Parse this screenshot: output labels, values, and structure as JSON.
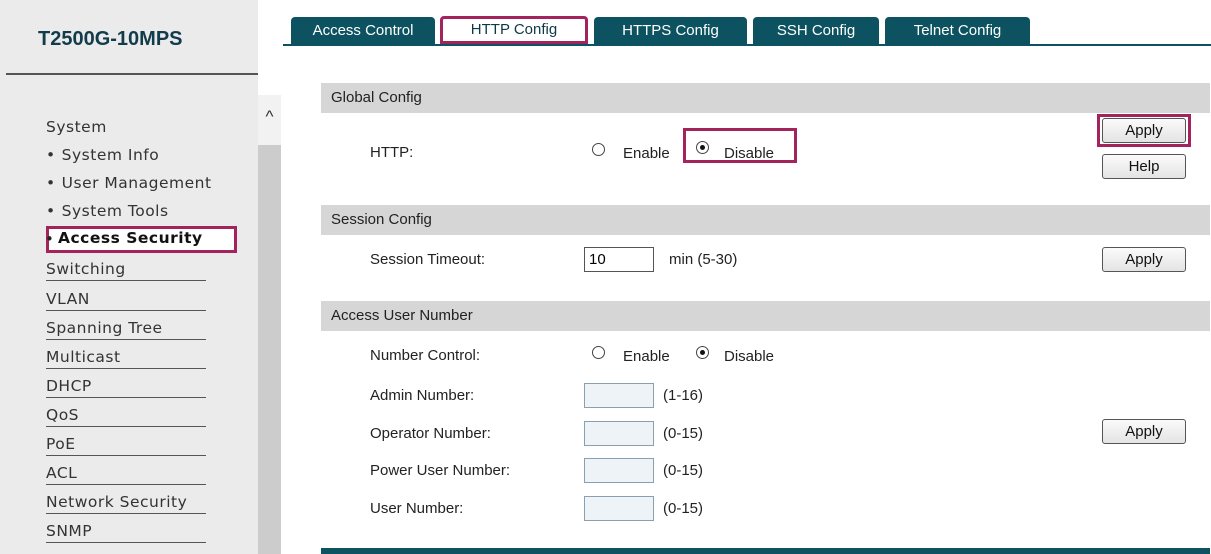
{
  "sidebar": {
    "model": "T2500G-10MPS",
    "scroll_up_glyph": "^",
    "system_label": "System",
    "sub_items": [
      "System Info",
      "User Management",
      "System Tools"
    ],
    "active_item": "Access Security",
    "categories": [
      "Switching",
      "VLAN",
      "Spanning Tree",
      "Multicast",
      "DHCP",
      "QoS",
      "PoE",
      "ACL",
      "Network Security",
      "SNMP"
    ]
  },
  "tabs": [
    "Access Control",
    "HTTP Config",
    "HTTPS Config",
    "SSH Config",
    "Telnet Config"
  ],
  "active_tab": "HTTP Config",
  "global_config": {
    "title": "Global Config",
    "http_label": "HTTP:",
    "enable_label": "Enable",
    "disable_label": "Disable",
    "selected": "Disable",
    "apply_label": "Apply",
    "help_label": "Help"
  },
  "session_config": {
    "title": "Session Config",
    "timeout_label": "Session Timeout:",
    "timeout_value": "10",
    "timeout_unit": "min (5-30)",
    "apply_label": "Apply"
  },
  "access_user_number": {
    "title": "Access User Number",
    "number_control_label": "Number Control:",
    "enable_label": "Enable",
    "disable_label": "Disable",
    "selected": "Disable",
    "rows": [
      {
        "label": "Admin Number:",
        "range": "(1-16)",
        "value": ""
      },
      {
        "label": "Operator Number:",
        "range": "(0-15)",
        "value": ""
      },
      {
        "label": "Power User Number:",
        "range": "(0-15)",
        "value": ""
      },
      {
        "label": "User Number:",
        "range": "(0-15)",
        "value": ""
      }
    ],
    "apply_label": "Apply"
  },
  "colors": {
    "accent_highlight": "#a3235c",
    "tab_background": "#0c5260",
    "section_header": "#d6d6d6",
    "sidebar_background": "#ebebeb"
  }
}
